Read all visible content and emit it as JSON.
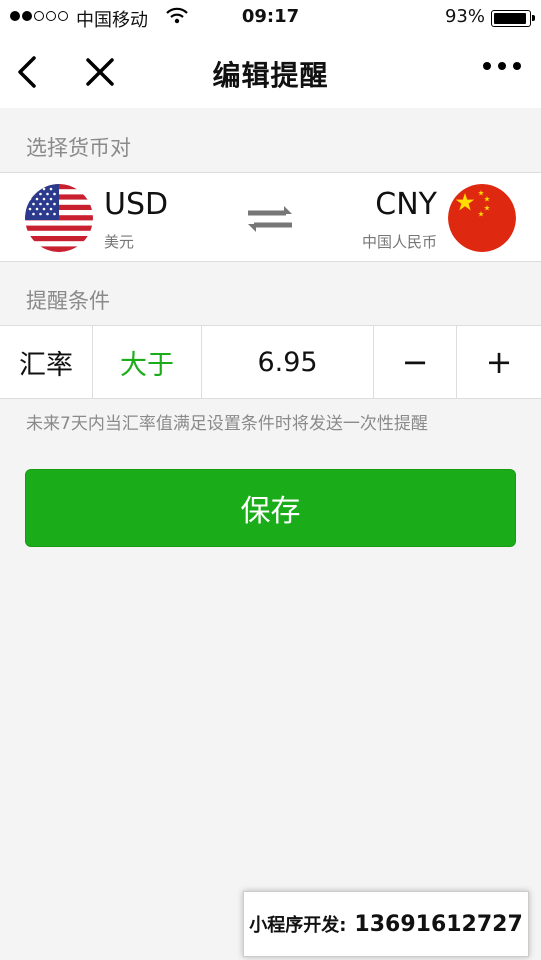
{
  "status_bar": {
    "carrier": "中国移动",
    "time": "09:17",
    "battery": "93%",
    "battery_level": 0.93
  },
  "nav": {
    "title": "编辑提醒",
    "back_icon": "chevron-left-icon",
    "close_icon": "close-icon",
    "more_icon": "more-icon"
  },
  "currency_section": {
    "label": "选择货币对",
    "from": {
      "code": "USD",
      "name": "美元",
      "flag": "us-flag-icon"
    },
    "to": {
      "code": "CNY",
      "name": "中国人民币",
      "flag": "cn-flag-icon"
    },
    "swap_icon": "swap-arrows-icon"
  },
  "condition_section": {
    "label": "提醒条件",
    "type_label": "汇率",
    "comparator": "大于",
    "value": "6.95",
    "minus_label": "−",
    "plus_label": "+"
  },
  "hint": "未来7天内当汇率值满足设置条件时将发送一次性提醒",
  "save_label": "保存",
  "watermark": {
    "label": "小程序开发:",
    "phone": "13691612727"
  },
  "colors": {
    "accent_green": "#1aad19",
    "background": "#f4f4f4"
  }
}
